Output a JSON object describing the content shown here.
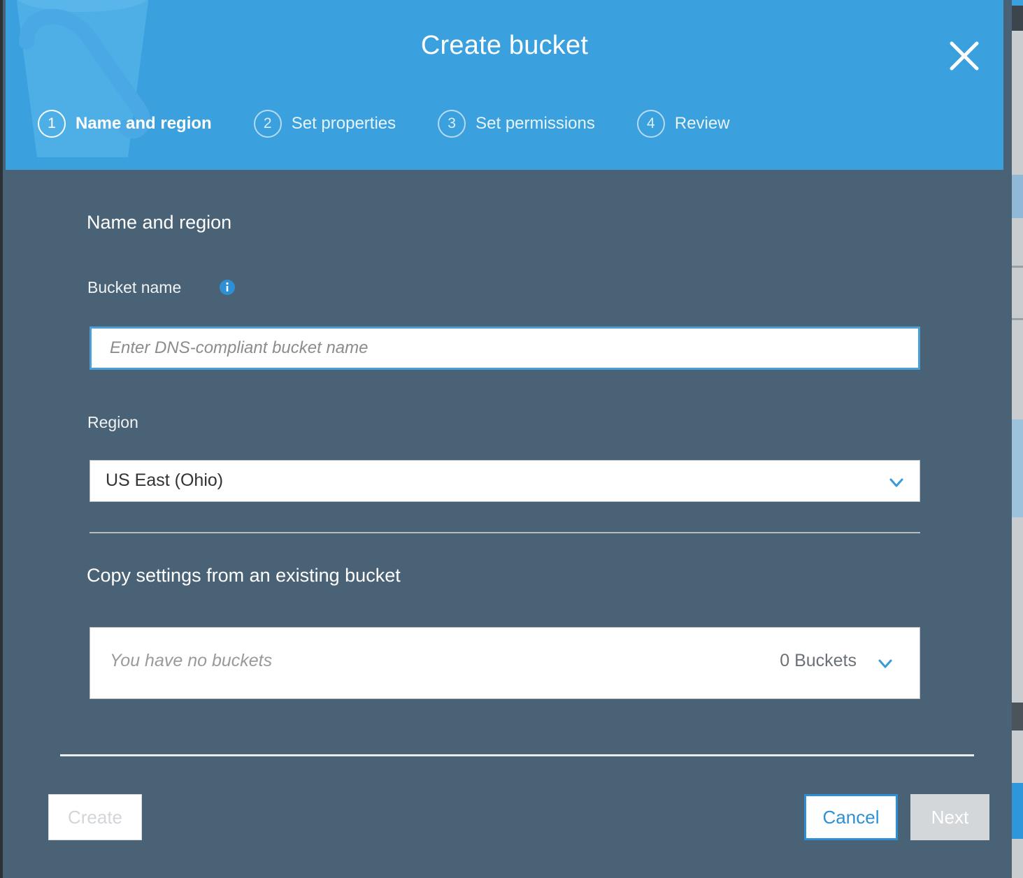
{
  "dialog": {
    "title": "Create bucket",
    "close_icon": "close-icon"
  },
  "steps": [
    {
      "number": "1",
      "label": "Name and region",
      "active": true
    },
    {
      "number": "2",
      "label": "Set properties",
      "active": false
    },
    {
      "number": "3",
      "label": "Set permissions",
      "active": false
    },
    {
      "number": "4",
      "label": "Review",
      "active": false
    }
  ],
  "form": {
    "section_heading": "Name and region",
    "bucket_name": {
      "label": "Bucket name",
      "info_icon": "info-icon",
      "value": "",
      "placeholder": "Enter DNS-compliant bucket name"
    },
    "region": {
      "label": "Region",
      "value": "US East (Ohio)",
      "chevron_icon": "chevron-down-icon"
    }
  },
  "copy_settings": {
    "heading": "Copy settings from an existing bucket",
    "placeholder": "You have no buckets",
    "count": "0 Buckets",
    "chevron_icon": "chevron-down-icon"
  },
  "footer": {
    "create_label": "Create",
    "cancel_label": "Cancel",
    "next_label": "Next"
  },
  "colors": {
    "header_blue": "#3aa0de",
    "body_slate": "#4a6275",
    "accent_blue": "#2f8fd4",
    "disabled_gray": "#d3d7da"
  }
}
